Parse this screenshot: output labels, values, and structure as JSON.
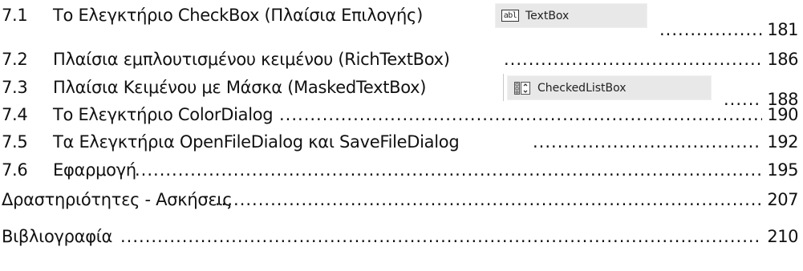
{
  "toc": [
    {
      "num": "7.1",
      "title": "Το Ελεγκτήριο CheckBox (Πλαίσια Επιλογής)",
      "page": "181"
    },
    {
      "num": "7.2",
      "title": "Πλαίσια εμπλουτισμένου κειμένου (RichTextBox)",
      "page": "186"
    },
    {
      "num": "7.3",
      "title": "Πλαίσια Κειμένου με Μάσκα (MaskedTextBox)",
      "page": "188"
    },
    {
      "num": "7.4",
      "title": "Το Ελεγκτήριο ColorDialog",
      "page": "190"
    },
    {
      "num": "7.5",
      "title": "Τα Ελεγκτήρια OpenFileDialog και SaveFileDialog",
      "page": "192"
    },
    {
      "num": "7.6",
      "title": "Εφαρμογή",
      "page": "195"
    },
    {
      "num": "",
      "title": "Δραστηριότητες - Ασκήσεις",
      "page": "207"
    },
    {
      "num": "",
      "title": "Βιβλιογραφία",
      "page": "210"
    }
  ],
  "toolbox": {
    "textbox": {
      "icon_text": "abl",
      "label": "TextBox",
      "icon": "textbox-icon"
    },
    "checkedlistbox": {
      "label": "CheckedListBox",
      "icon": "checkedlistbox-icon"
    }
  },
  "leader_dots": "......................................................................................................................................................................................................"
}
